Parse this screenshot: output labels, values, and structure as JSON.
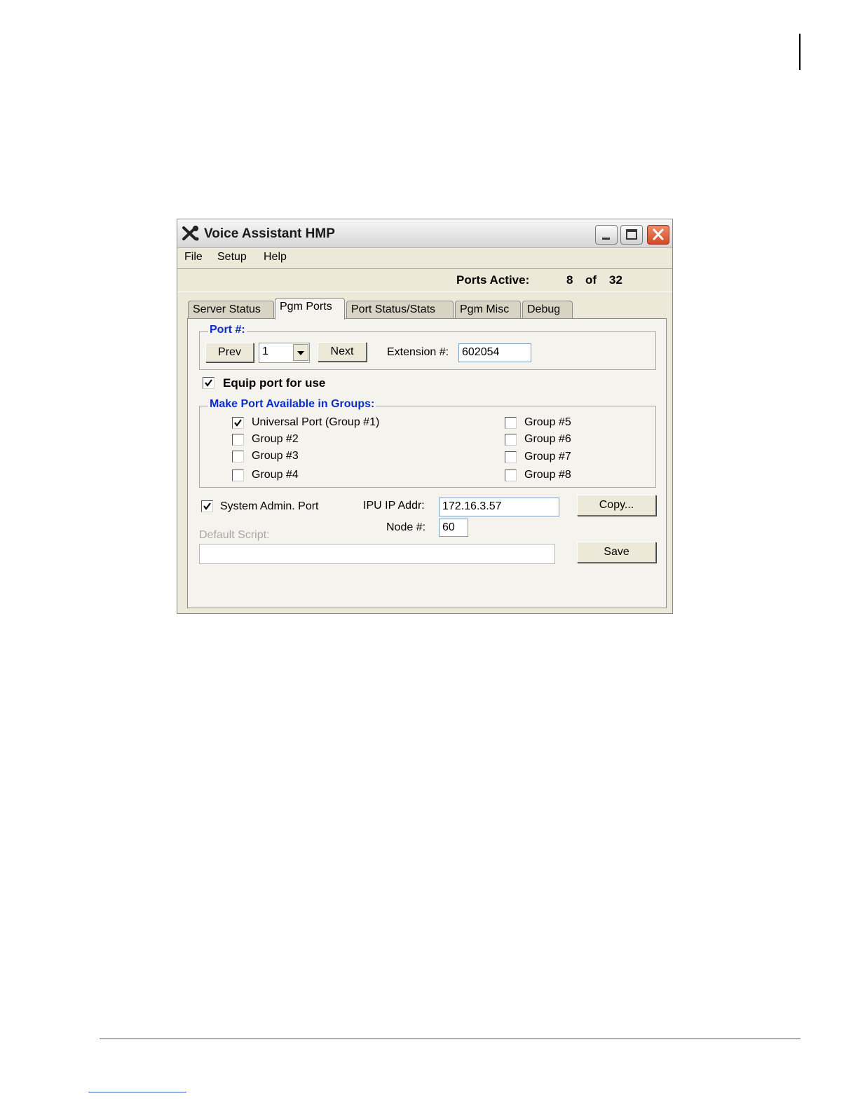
{
  "window": {
    "title": "Voice Assistant HMP",
    "icon": "tools-icon"
  },
  "menu": [
    "File",
    "Setup",
    "Help"
  ],
  "status": {
    "label": "Ports Active:",
    "active": "8",
    "of": "of",
    "total": "32"
  },
  "tabs": [
    "Server Status",
    "Pgm Ports",
    "Port Status/Stats",
    "Pgm Misc",
    "Debug"
  ],
  "active_tab": "Pgm Ports",
  "port": {
    "legend": "Port #:",
    "prev_label": "Prev",
    "selected": "1",
    "next_label": "Next",
    "extension_label": "Extension #:",
    "extension_value": "602054"
  },
  "equip": {
    "label": "Equip port for use",
    "checked": true
  },
  "groups": {
    "legend": "Make Port Available in Groups:",
    "items": [
      {
        "label": "Universal Port (Group #1)",
        "checked": true
      },
      {
        "label": "Group #2",
        "checked": false
      },
      {
        "label": "Group #3",
        "checked": false
      },
      {
        "label": "Group #4",
        "checked": false
      },
      {
        "label": "Group #5",
        "checked": false
      },
      {
        "label": "Group #6",
        "checked": false
      },
      {
        "label": "Group #7",
        "checked": false
      },
      {
        "label": "Group #8",
        "checked": false
      }
    ]
  },
  "admin": {
    "label": "System Admin. Port",
    "checked": true
  },
  "ipu": {
    "label": "IPU IP Addr:",
    "value": "172.16.3.57"
  },
  "node": {
    "label": "Node #:",
    "value": "60"
  },
  "copy_label": "Copy...",
  "default_script": {
    "label": "Default Script:",
    "value": ""
  },
  "save_label": "Save"
}
